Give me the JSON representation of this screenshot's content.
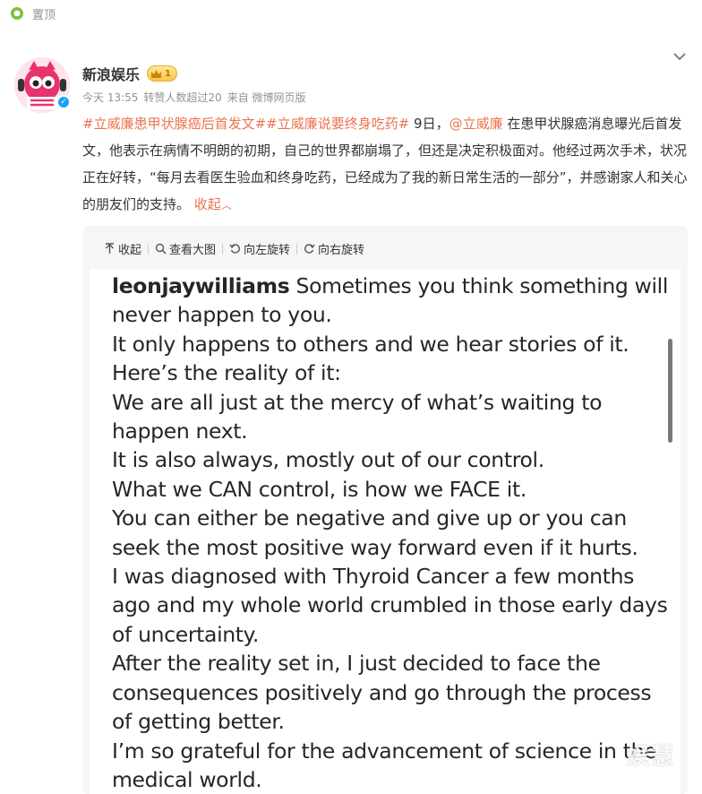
{
  "pin": {
    "label": "置顶",
    "icon": "pin-icon"
  },
  "post": {
    "author": "新浪娱乐",
    "vip_level": "1",
    "meta": {
      "time": "今天 13:55",
      "reposts": "转赞人数超过20",
      "source": "来自 微博网页版"
    },
    "text": {
      "topic1": "#立威廉患甲状腺癌后首发文#",
      "topic2": "#立威廉说要终身吃药#",
      "date_prefix": " 9日，",
      "mention": "@立威廉",
      "body": " 在患甲状腺癌消息曝光后首发文，他表示在病情不明朗的初期，自己的世界都崩塌了，但还是决定积极面对。他经过两次手术，状况正在好转，“每月去看医生验血和终身吃药，已经成为了我的新日常生活的一部分”，并感谢家人和关心的朋友们的支持。",
      "collapse": "收起"
    }
  },
  "toolbar": {
    "collapse": "收起",
    "view_large": "查看大图",
    "rotate_left": "向左旋转",
    "rotate_right": "向右旋转"
  },
  "image_text": {
    "username": "leonjaywilliams",
    "lines": [
      "Sometimes you think something will never happen to you.",
      "It only happens to others and we hear stories of it.",
      "Here’s the reality of it:",
      "We are all just at the mercy of what’s waiting to happen next.",
      "It is also always, mostly out of our control.",
      "What we CAN control, is how we FACE it.",
      "You can either be negative and give up or you can seek the most positive way forward even if it hurts.",
      "I was diagnosed with Thyroid Cancer a few months ago and my whole world crumbled in those early days of uncertainty.",
      "After the reality set in, I just decided to face the consequences positively and go through the process of getting better.",
      "I’m so grateful for the advancement of science in the medical world."
    ]
  },
  "watermark": "娱慧",
  "colors": {
    "accent": "#eb7350",
    "muted": "#939393",
    "panel": "#f6f6f6",
    "verified": "#1da1f2"
  }
}
